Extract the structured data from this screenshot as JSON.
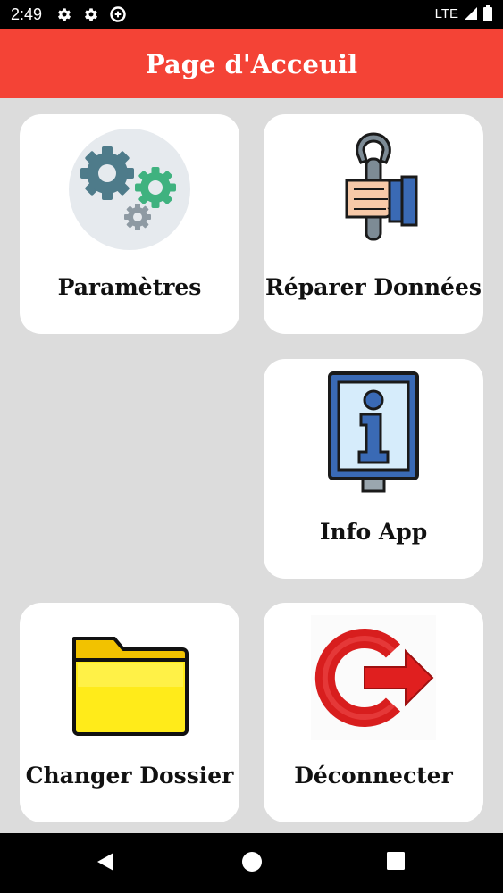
{
  "status_bar": {
    "time": "2:49",
    "network": "LTE",
    "icons": [
      "settings-icon",
      "settings-icon",
      "data-saver-icon",
      "signal-icon",
      "battery-icon"
    ]
  },
  "app_bar": {
    "title": "Page d'Acceuil"
  },
  "cards": {
    "params": {
      "label": "Paramètres",
      "icon": "gears-icon"
    },
    "repair": {
      "label": "Réparer Données",
      "icon": "wrench-hand-icon"
    },
    "info": {
      "label": "Info App",
      "icon": "info-sign-icon"
    },
    "folder": {
      "label": "Changer Dossier",
      "icon": "folder-icon"
    },
    "logout": {
      "label": "Déconnecter",
      "icon": "logout-arrow-icon"
    }
  },
  "nav_bar": {
    "buttons": [
      "back-icon",
      "home-icon",
      "recents-icon"
    ]
  },
  "colors": {
    "app_bar": "#f44336",
    "background": "#dcdcdc",
    "card": "#ffffff"
  }
}
